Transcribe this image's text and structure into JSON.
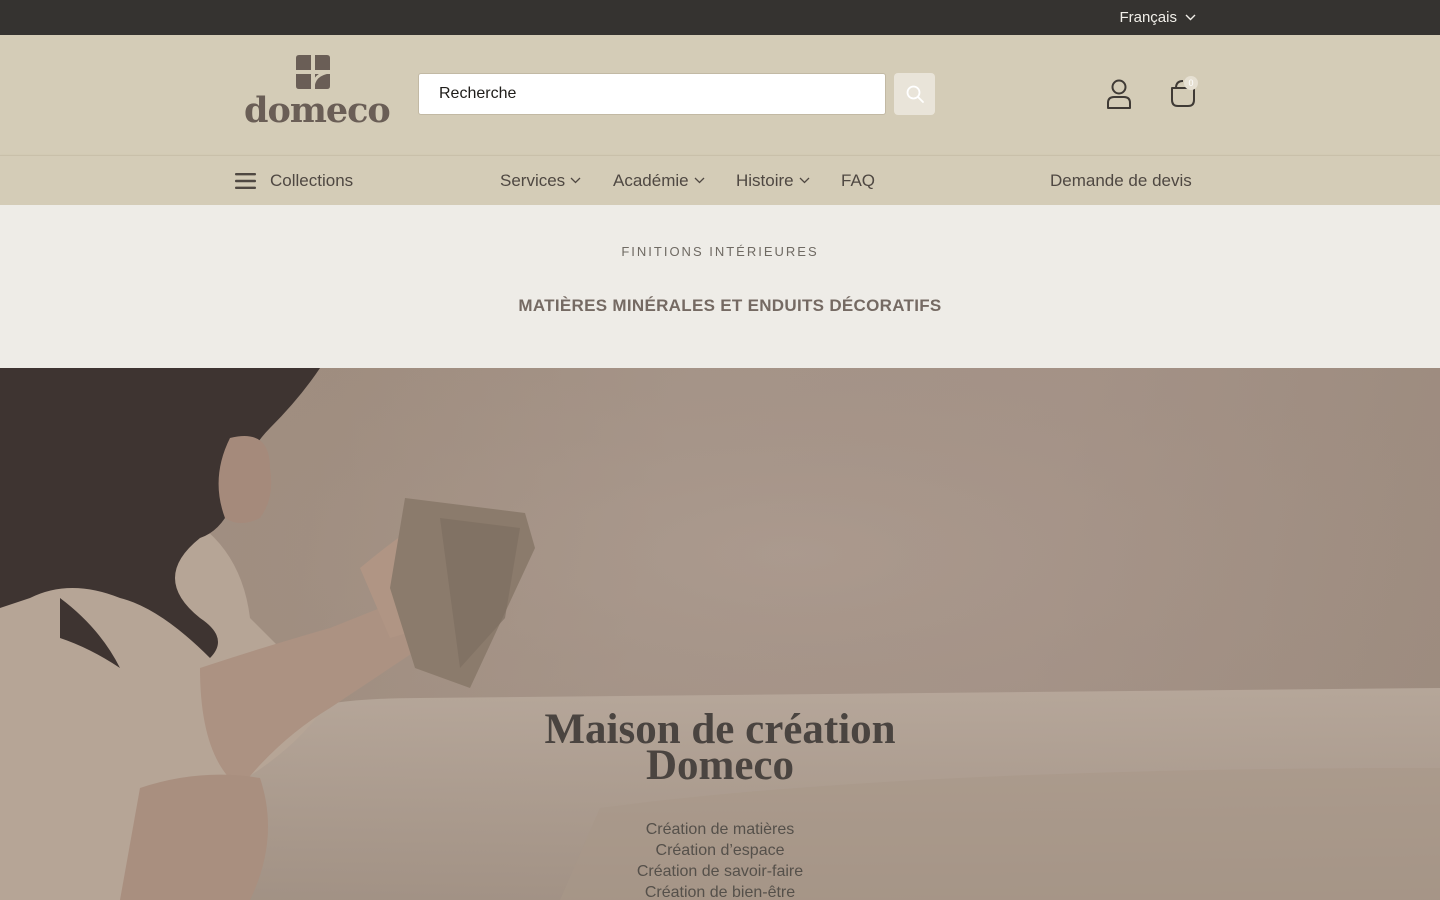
{
  "topbar": {
    "language": "Français"
  },
  "header": {
    "logo_text": "domeco",
    "search": {
      "placeholder": "Recherche"
    },
    "cart_count": "0"
  },
  "nav": {
    "collections": "Collections",
    "services": "Services",
    "academie": "Académie",
    "histoire": "Histoire",
    "faq": "FAQ",
    "quote": "Demande de devis"
  },
  "tagline": {
    "eyebrow": "FINITIONS INTÉRIEURES",
    "subhead": "MATIÈRES MINÉRALES ET ENDUITS DÉCORATIFS"
  },
  "hero": {
    "title_line1": "Maison de création",
    "title_line2": "Domeco",
    "lines": [
      "Création de matières",
      "Création d’espace",
      "Création de savoir-faire",
      "Création de bien-être"
    ]
  },
  "icons": {
    "language_chevron": "chevron-down-icon",
    "search": "search-icon",
    "account": "user-icon",
    "cart": "bag-icon",
    "menu": "hamburger-menu-icon"
  },
  "colors": {
    "topbar": "#353330",
    "header": "#d4ccb7",
    "page": "#eeece7",
    "logo": "#6a5e56",
    "text": "#4a4540"
  }
}
